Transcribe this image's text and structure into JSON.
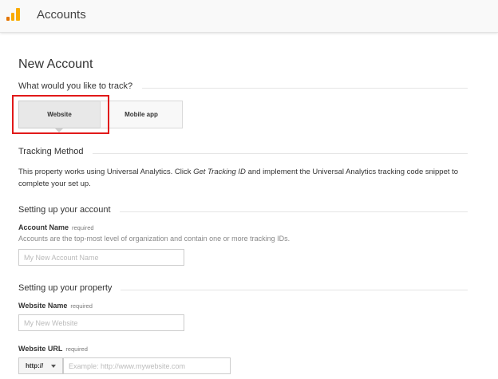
{
  "header": {
    "title": "Accounts",
    "logo_icon": "analytics-bars-icon",
    "logo_colors": [
      "#f9ab00",
      "#e37400"
    ]
  },
  "page_title": "New Account",
  "track": {
    "question": "What would you like to track?",
    "options": [
      {
        "label": "Website",
        "selected": true
      },
      {
        "label": "Mobile app",
        "selected": false
      }
    ],
    "highlight_color": "#e11919"
  },
  "tracking_method": {
    "title": "Tracking Method",
    "description_prefix": "This property works using Universal Analytics. Click ",
    "description_emphasis": "Get Tracking ID",
    "description_suffix": " and implement the Universal Analytics tracking code snippet to complete your set up."
  },
  "account_setup": {
    "title": "Setting up your account",
    "name_label": "Account Name",
    "required_text": "required",
    "help": "Accounts are the top-most level of organization and contain one or more tracking IDs.",
    "name_placeholder": "My New Account Name",
    "name_value": ""
  },
  "property_setup": {
    "title": "Setting up your property",
    "website_name_label": "Website Name",
    "required_text": "required",
    "website_name_placeholder": "My New Website",
    "website_name_value": "",
    "website_url_label": "Website URL",
    "protocol_value": "http://",
    "url_placeholder": "Example: http://www.mywebsite.com",
    "url_value": ""
  }
}
